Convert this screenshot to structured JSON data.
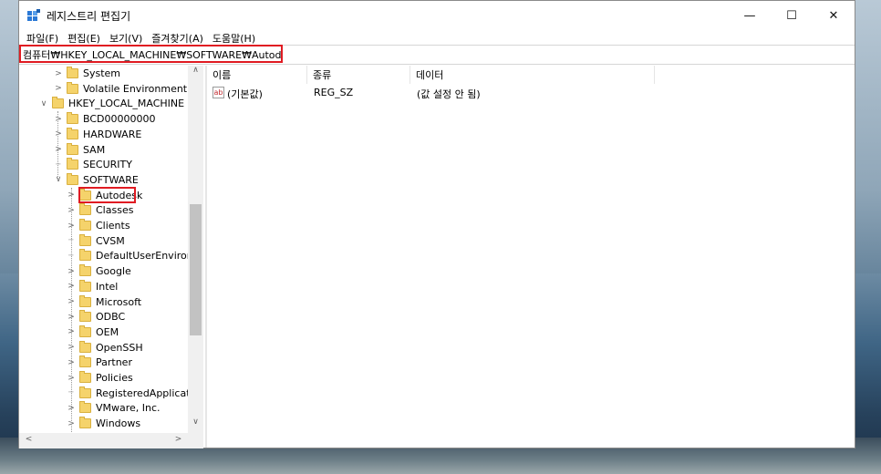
{
  "window": {
    "title": "레지스트리 편집기",
    "controls": {
      "minimize": "—",
      "maximize": "☐",
      "close": "✕"
    }
  },
  "menu": [
    "파일(F)",
    "편집(E)",
    "보기(V)",
    "즐겨찾기(A)",
    "도움말(H)"
  ],
  "address": "컴퓨터₩HKEY_LOCAL_MACHINE₩SOFTWARE₩Autodesk",
  "tree": [
    {
      "label": "System",
      "expander": ">"
    },
    {
      "label": "Volatile Environment",
      "expander": ">"
    },
    {
      "label": "HKEY_LOCAL_MACHINE",
      "expander": "v"
    },
    {
      "label": "BCD00000000",
      "expander": ">"
    },
    {
      "label": "HARDWARE",
      "expander": ">"
    },
    {
      "label": "SAM",
      "expander": ">"
    },
    {
      "label": "SECURITY",
      "expander": ""
    },
    {
      "label": "SOFTWARE",
      "expander": "v"
    },
    {
      "label": "Autodesk",
      "expander": ">"
    },
    {
      "label": "Classes",
      "expander": ">"
    },
    {
      "label": "Clients",
      "expander": ">"
    },
    {
      "label": "CVSM",
      "expander": ""
    },
    {
      "label": "DefaultUserEnvironn",
      "expander": ""
    },
    {
      "label": "Google",
      "expander": ">"
    },
    {
      "label": "Intel",
      "expander": ">"
    },
    {
      "label": "Microsoft",
      "expander": ">"
    },
    {
      "label": "ODBC",
      "expander": ">"
    },
    {
      "label": "OEM",
      "expander": ">"
    },
    {
      "label": "OpenSSH",
      "expander": ">"
    },
    {
      "label": "Partner",
      "expander": ">"
    },
    {
      "label": "Policies",
      "expander": ">"
    },
    {
      "label": "RegisteredApplicatic",
      "expander": ""
    },
    {
      "label": "VMware, Inc.",
      "expander": ">"
    },
    {
      "label": "Windows",
      "expander": ">"
    }
  ],
  "list": {
    "headers": {
      "name": "이름",
      "type": "종류",
      "data": "데이터"
    },
    "rows": [
      {
        "icon": "ab",
        "name": "(기본값)",
        "type": "REG_SZ",
        "data": "(값 설정 안 됨)"
      }
    ]
  },
  "scroll": {
    "up": "∧",
    "down": "∨",
    "left": "<",
    "right": ">"
  },
  "colors": {
    "highlight": "#e01b22",
    "folder": "#f5d36b"
  }
}
